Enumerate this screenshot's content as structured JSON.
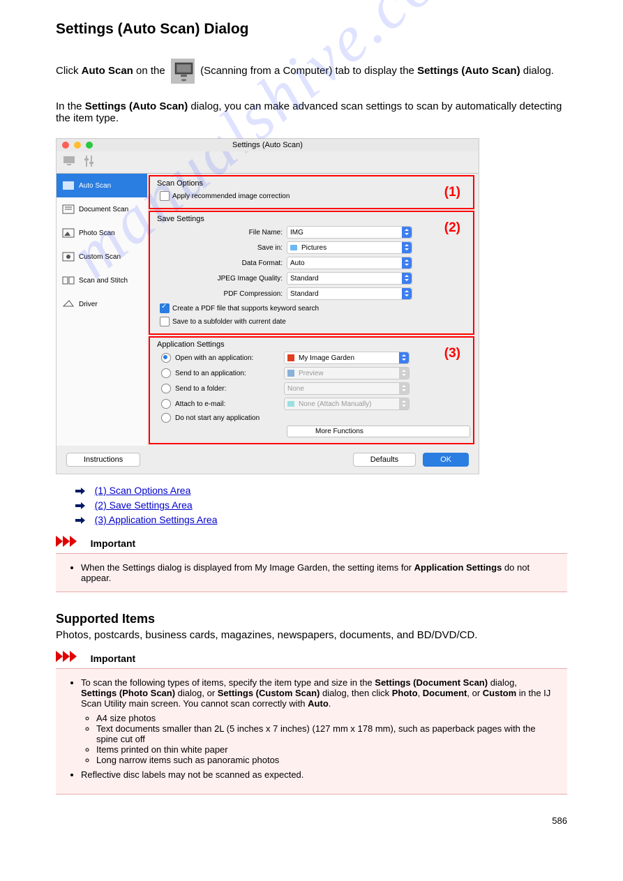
{
  "intro_text_1": "Settings (Auto Scan) Dialog",
  "intro_text_2": "Click Auto Scan on the  (Scanning from a Computer) tab to display the Settings (Auto Scan) dialog.",
  "intro_text_3": "In the Settings (Auto Scan) dialog, you can make advanced scan settings to scan by automatically detecting the item type.",
  "window": {
    "title": "Settings (Auto Scan)",
    "sidebar": {
      "items": [
        {
          "label": "Auto Scan",
          "active": true
        },
        {
          "label": "Document Scan"
        },
        {
          "label": "Photo Scan"
        },
        {
          "label": "Custom Scan"
        },
        {
          "label": "Scan and Stitch"
        },
        {
          "label": "Driver"
        }
      ]
    },
    "scan_options": {
      "header": "Scan Options",
      "apply_correction": "Apply recommended image correction",
      "num": "(1)"
    },
    "save_settings": {
      "header": "Save Settings",
      "num": "(2)",
      "file_name_label": "File Name:",
      "file_name_value": "IMG",
      "save_in_label": "Save in:",
      "save_in_value": "Pictures",
      "data_format_label": "Data Format:",
      "data_format_value": "Auto",
      "jpeg_label": "JPEG Image Quality:",
      "jpeg_value": "Standard",
      "pdf_comp_label": "PDF Compression:",
      "pdf_comp_value": "Standard",
      "create_pdf": "Create a PDF file that supports keyword search",
      "save_subfolder": "Save to a subfolder with current date"
    },
    "app_settings": {
      "header": "Application Settings",
      "num": "(3)",
      "open_app": "Open with an application:",
      "open_app_value": "My Image Garden",
      "send_app": "Send to an application:",
      "send_app_value": "Preview",
      "send_folder": "Send to a folder:",
      "send_folder_value": "None",
      "attach_email": "Attach to e-mail:",
      "attach_email_value": "None (Attach Manually)",
      "no_start": "Do not start any application",
      "more_functions": "More Functions"
    },
    "buttons": {
      "instructions": "Instructions",
      "defaults": "Defaults",
      "ok": "OK"
    }
  },
  "jumps": {
    "a": "(1) Scan Options Area",
    "b": "(2) Save Settings Area",
    "c": "(3) Application Settings Area"
  },
  "important_label": "Important",
  "important_note": "When the Settings dialog is displayed from My Image Garden, the setting items for Application Settings do not appear.",
  "supported_header": "Supported Items",
  "supported_text": "Photos, postcards, business cards, magazines, newspapers, documents, and BD/DVD/CD.",
  "important2": {
    "p1": "To scan the following types of items, specify the item type and size in the Settings (Document Scan) dialog, Settings (Photo Scan) dialog, or Settings (Custom Scan) dialog, then click Photo, Document, or Custom in the IJ Scan Utility main screen. You cannot scan correctly with Auto.",
    "li1": "A4 size photos",
    "li2": "Text documents smaller than 2L (5 inches x 7 inches) (127 mm x 178 mm), such as paperback pages with the spine cut off",
    "li3": "Items printed on thin white paper",
    "li4": "Long narrow items such as panoramic photos",
    "p2": "Reflective disc labels may not be scanned as expected."
  },
  "watermark": "manualshive.com",
  "page_num": "586"
}
